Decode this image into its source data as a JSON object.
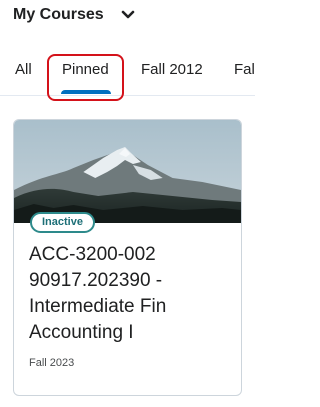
{
  "header": {
    "title": "My Courses",
    "menu_icon": "chevron-down-icon"
  },
  "tabs": [
    {
      "label": "All",
      "selected": false
    },
    {
      "label": "Pinned",
      "selected": true
    },
    {
      "label": "Fall 2012",
      "selected": false
    },
    {
      "label": "Fal",
      "selected": false
    }
  ],
  "course_card": {
    "status_badge": "Inactive",
    "title": "ACC-3200-002 90917.202390 - Intermediate Fin Accounting I",
    "term": "Fall 2023",
    "image": "mountain-landscape"
  },
  "colors": {
    "accent": "#006fbf",
    "focus_ring": "#d4121a",
    "badge_border": "#2d8a8b"
  }
}
